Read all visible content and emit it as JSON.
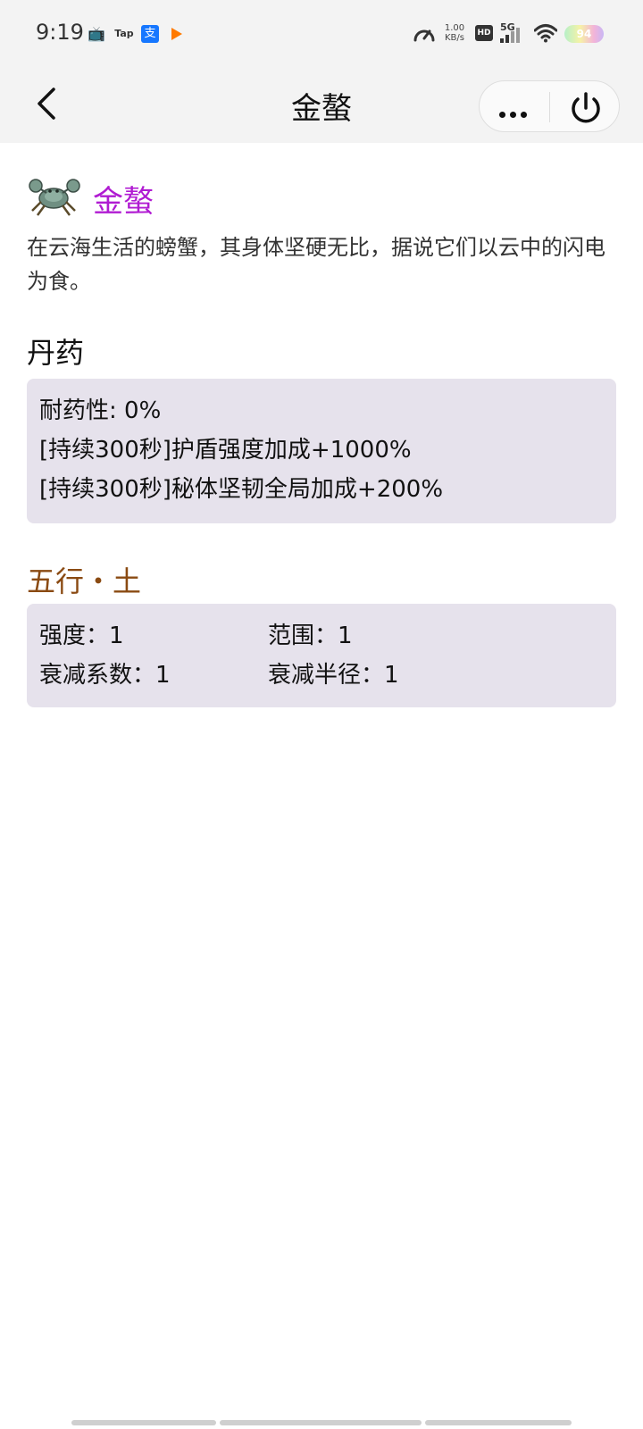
{
  "status_bar": {
    "time": "9:19",
    "app_icons": [
      "tv-icon",
      "tap-icon",
      "alipay-icon",
      "play-icon"
    ],
    "tap_label": "Tap",
    "alipay_label": "支",
    "net_speed_value": "1.00",
    "net_speed_unit": "KB/s",
    "hd_label": "HD",
    "network_label": "5G",
    "battery_level": "94"
  },
  "nav": {
    "title": "金螯"
  },
  "item": {
    "name": "金螯",
    "name_color": "#b01bd2",
    "description": "在云海生活的螃蟹，其身体坚硬无比，据说它们以云中的闪电为食。"
  },
  "pill_section": {
    "title": "丹药",
    "lines": [
      "耐药性: 0%",
      "[持续300秒]护盾强度加成+1000%",
      "[持续300秒]秘体坚韧全局加成+200%"
    ]
  },
  "element_section": {
    "title": "五行・土",
    "title_color": "#8a4a12",
    "stats": [
      "强度：1",
      "范围：1",
      "衰减系数：1",
      "衰减半径：1"
    ]
  },
  "colors": {
    "panel_bg": "#e6e2ec",
    "bar_bg": "#f3f3f3"
  }
}
